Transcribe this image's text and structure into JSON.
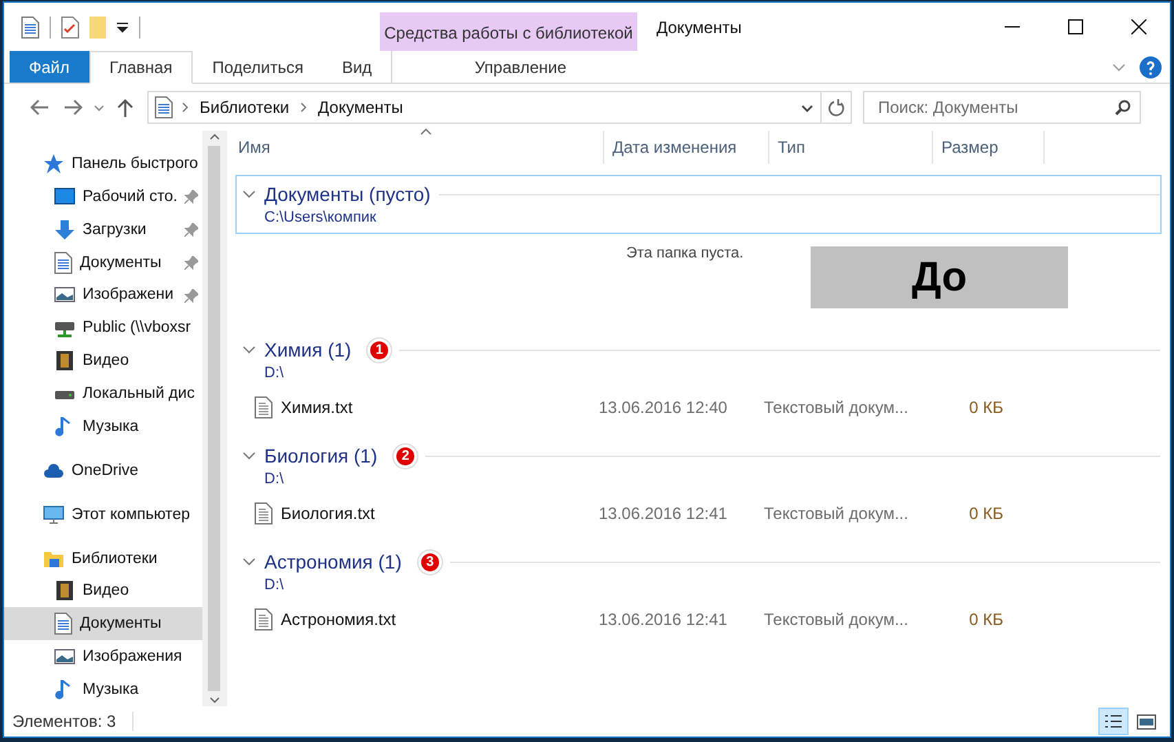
{
  "window": {
    "title": "Документы",
    "context_group": "Средства работы с библиотекой"
  },
  "ribbon_tabs": [
    {
      "label": "Файл",
      "kind": "file",
      "selected": false
    },
    {
      "label": "Главная",
      "kind": "plain",
      "selected": true
    },
    {
      "label": "Поделиться",
      "kind": "plain",
      "selected": false
    },
    {
      "label": "Вид",
      "kind": "plain",
      "selected": false
    },
    {
      "label": "Управление",
      "kind": "context",
      "selected": false
    }
  ],
  "address": {
    "crumbs": [
      "Библиотеки",
      "Документы"
    ]
  },
  "search": {
    "placeholder": "Поиск: Документы"
  },
  "sidebar": {
    "items": [
      {
        "label": "Панель быстрого",
        "kind": "star",
        "selected": false,
        "children": [
          {
            "label": "Рабочий сто.",
            "kind": "desktop",
            "pinned": true,
            "selected": false
          },
          {
            "label": "Загрузки",
            "kind": "download",
            "pinned": true,
            "selected": false
          },
          {
            "label": "Документы",
            "kind": "document",
            "pinned": true,
            "selected": false
          },
          {
            "label": "Изображени",
            "kind": "image",
            "pinned": true,
            "selected": false
          },
          {
            "label": "Public (\\\\vboxsr",
            "kind": "netdrive",
            "pinned": false,
            "selected": false
          },
          {
            "label": "Видео",
            "kind": "video",
            "pinned": false,
            "selected": false
          },
          {
            "label": "Локальный дис",
            "kind": "drive",
            "pinned": false,
            "selected": false
          },
          {
            "label": "Музыка",
            "kind": "music",
            "pinned": false,
            "selected": false
          }
        ]
      },
      {
        "label": "OneDrive",
        "kind": "cloud",
        "selected": false
      },
      {
        "label": "Этот компьютер",
        "kind": "computer",
        "selected": false
      },
      {
        "label": "Библиотеки",
        "kind": "folder",
        "selected": false,
        "children": [
          {
            "label": "Видео",
            "kind": "video",
            "pinned": false,
            "selected": false
          },
          {
            "label": "Документы",
            "kind": "document",
            "pinned": false,
            "selected": true
          },
          {
            "label": "Изображения",
            "kind": "image",
            "pinned": false,
            "selected": false
          },
          {
            "label": "Музыка",
            "kind": "music",
            "pinned": false,
            "selected": false
          }
        ]
      }
    ]
  },
  "table": {
    "columns": [
      "Имя",
      "Дата изменения",
      "Тип",
      "Размер"
    ],
    "groups": [
      {
        "title": "Документы (пусто)",
        "path": "C:\\Users\\компик",
        "selected": true,
        "empty_text": "Эта папка пуста.",
        "overlay_label": "До"
      },
      {
        "title": "Химия (1)",
        "path": "D:\\",
        "selected": false,
        "badge": "1",
        "files": [
          {
            "name": "Химия.txt",
            "date": "13.06.2016 12:40",
            "type": "Текстовый докум...",
            "size": "0 КБ"
          }
        ]
      },
      {
        "title": "Биология (1)",
        "path": "D:\\",
        "selected": false,
        "badge": "2",
        "files": [
          {
            "name": "Биология.txt",
            "date": "13.06.2016 12:41",
            "type": "Текстовый докум...",
            "size": "0 КБ"
          }
        ]
      },
      {
        "title": "Астрономия (1)",
        "path": "D:\\",
        "selected": false,
        "badge": "3",
        "files": [
          {
            "name": "Астрономия.txt",
            "date": "13.06.2016 12:41",
            "type": "Текстовый докум...",
            "size": "0 КБ"
          }
        ]
      }
    ]
  },
  "status_bar": {
    "text": "Элементов: 3",
    "views": [
      {
        "kind": "details",
        "selected": true
      },
      {
        "kind": "tiles",
        "selected": false
      }
    ]
  }
}
